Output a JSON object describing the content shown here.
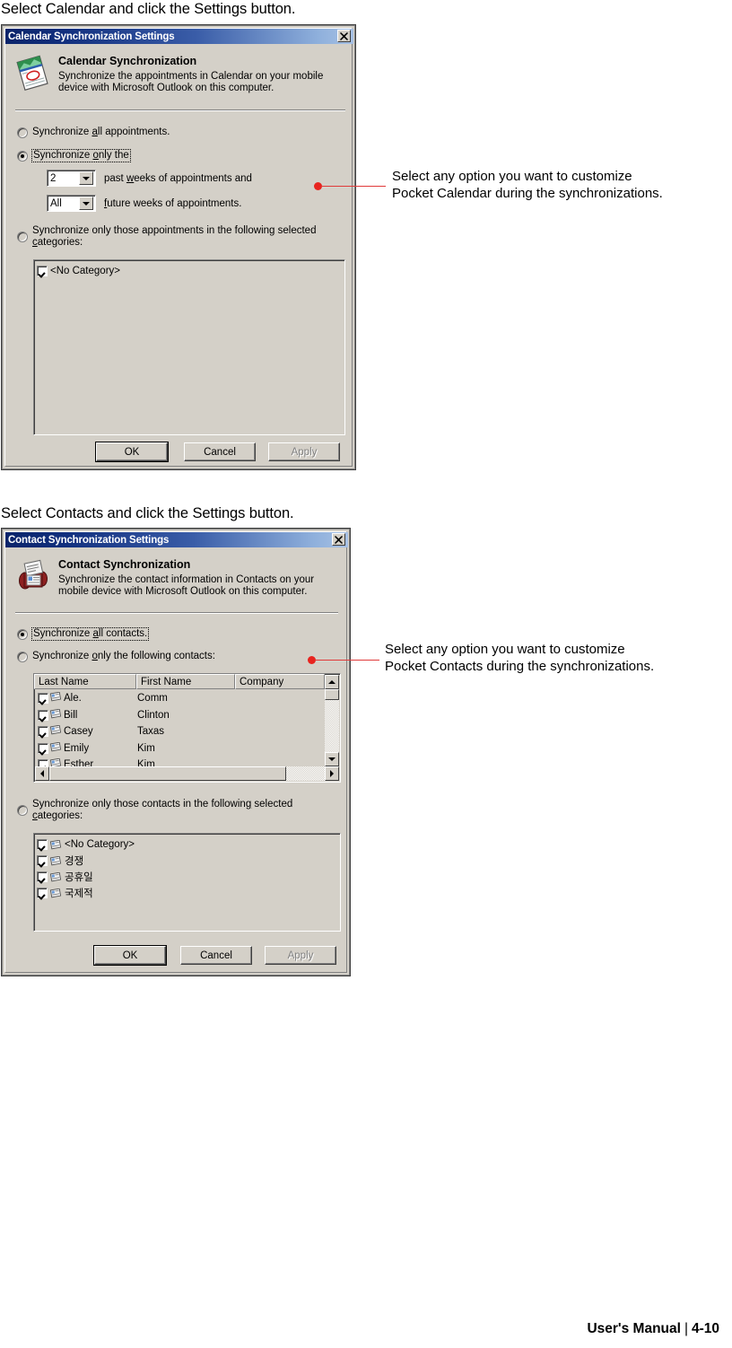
{
  "page": {
    "caption_calendar": "Select Calendar and click the Settings button.",
    "caption_contacts": "Select Contacts and click the Settings button.",
    "footer_title": "User's Manual",
    "footer_sep": "|",
    "footer_page": "4-10"
  },
  "annotations": {
    "calendar": {
      "line1": "Select any option you want to customize",
      "line2": "Pocket Calendar during the synchronizations.",
      "color": "#e8241f"
    },
    "contacts": {
      "line1": "Select any option you want to customize",
      "line2": "Pocket Contacts during the synchronizations.",
      "color": "#e8241f"
    }
  },
  "calendar_dialog": {
    "title": "Calendar Synchronization Settings",
    "close_icon": "close-icon",
    "app_icon": "calendar-icon",
    "heading": "Calendar Synchronization",
    "description_line1": "Synchronize the appointments in Calendar on your mobile",
    "description_line2": "device with Microsoft Outlook on this computer.",
    "options": [
      {
        "id": "all",
        "label_pre": "Synchronize ",
        "label_acc": "a",
        "label_post": "ll appointments.",
        "selected": false,
        "focused": false
      },
      {
        "id": "only_the",
        "label_pre": "Synchronize ",
        "label_acc": "o",
        "label_post": "nly the",
        "selected": true,
        "focused": true
      },
      {
        "id": "categories",
        "label_pre": "Synchronize only those appointments in the followin",
        "label_acc": "g",
        "label_post": " selected",
        "label_line2_acc": "c",
        "label_line2_post": "ategories:",
        "selected": false,
        "focused": false
      }
    ],
    "combo_past": {
      "value": "2",
      "label_pre": "past ",
      "label_acc": "w",
      "label_post": "eeks of appointments and"
    },
    "combo_future": {
      "value": "All",
      "label_pre": "",
      "label_acc": "f",
      "label_post": "uture weeks of appointments."
    },
    "category_list": [
      {
        "label": "<No Category>",
        "checked": true
      }
    ],
    "buttons": [
      {
        "id": "ok",
        "label": "OK",
        "default": true,
        "disabled": false
      },
      {
        "id": "cancel",
        "label": "Cancel",
        "default": false,
        "disabled": false
      },
      {
        "id": "apply",
        "label": "Apply",
        "default": false,
        "disabled": true
      }
    ]
  },
  "contact_dialog": {
    "title": "Contact Synchronization Settings",
    "close_icon": "close-icon",
    "app_icon": "contacts-icon",
    "heading": "Contact Synchronization",
    "description_line1": "Synchronize the contact information in Contacts on your",
    "description_line2": "mobile device with Microsoft Outlook on this computer.",
    "options": [
      {
        "id": "all",
        "label_pre": "Synchronize ",
        "label_acc": "a",
        "label_post": "ll contacts.",
        "selected": true,
        "focused": true
      },
      {
        "id": "following",
        "label_pre": "Synchronize ",
        "label_acc": "o",
        "label_post": "nly the following contacts:",
        "selected": false,
        "focused": false
      },
      {
        "id": "categories",
        "label_pre": "Synchronize only those contacts in the followin",
        "label_acc": "g",
        "label_post": " selected",
        "label_line2_acc": "c",
        "label_line2_post": "ategories:",
        "selected": false,
        "focused": false
      }
    ],
    "contacts_table": {
      "columns": [
        "Last Name",
        "First Name",
        "Company"
      ],
      "rows": [
        {
          "checked": true,
          "last_name": "Ale.",
          "first_name": "Comm",
          "company": ""
        },
        {
          "checked": true,
          "last_name": "Bill",
          "first_name": "Clinton",
          "company": ""
        },
        {
          "checked": true,
          "last_name": "Casey",
          "first_name": "Taxas",
          "company": ""
        },
        {
          "checked": true,
          "last_name": "Emily",
          "first_name": "Kim",
          "company": ""
        },
        {
          "checked": true,
          "last_name": "Esther",
          "first_name": "Kim",
          "company": ""
        }
      ]
    },
    "category_list": [
      {
        "label": "<No Category>",
        "checked": true
      },
      {
        "label": "경쟁",
        "checked": true
      },
      {
        "label": "공휴일",
        "checked": true
      },
      {
        "label": "국제적",
        "checked": true
      }
    ],
    "buttons": [
      {
        "id": "ok",
        "label": "OK",
        "default": true,
        "disabled": false
      },
      {
        "id": "cancel",
        "label": "Cancel",
        "default": false,
        "disabled": false
      },
      {
        "id": "apply",
        "label": "Apply",
        "default": false,
        "disabled": true
      }
    ]
  }
}
